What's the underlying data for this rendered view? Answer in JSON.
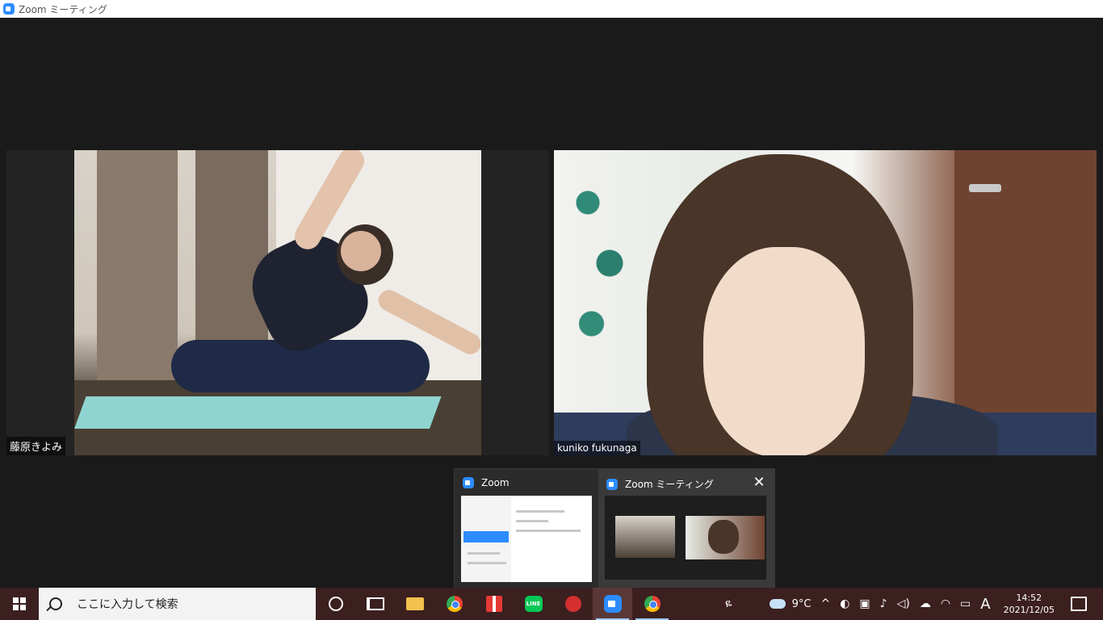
{
  "window": {
    "title": "Zoom ミーティング"
  },
  "participants": [
    {
      "name": "藤原きよみ"
    },
    {
      "name": "kuniko fukunaga"
    }
  ],
  "preview": {
    "items": [
      {
        "title": "Zoom"
      },
      {
        "title": "Zoom ミーティング"
      }
    ],
    "close_glyph": "✕"
  },
  "taskbar": {
    "search_placeholder": "ここに入力して検索",
    "apps": [
      "cortana",
      "task-view",
      "file-explorer",
      "chrome",
      "gift",
      "line",
      "trend-micro",
      "zoom",
      "chrome"
    ],
    "line_label": "LINE",
    "weather": {
      "temp": "9°C"
    },
    "ime": "A",
    "clock": {
      "time": "14:52",
      "date": "2021/12/05"
    }
  }
}
